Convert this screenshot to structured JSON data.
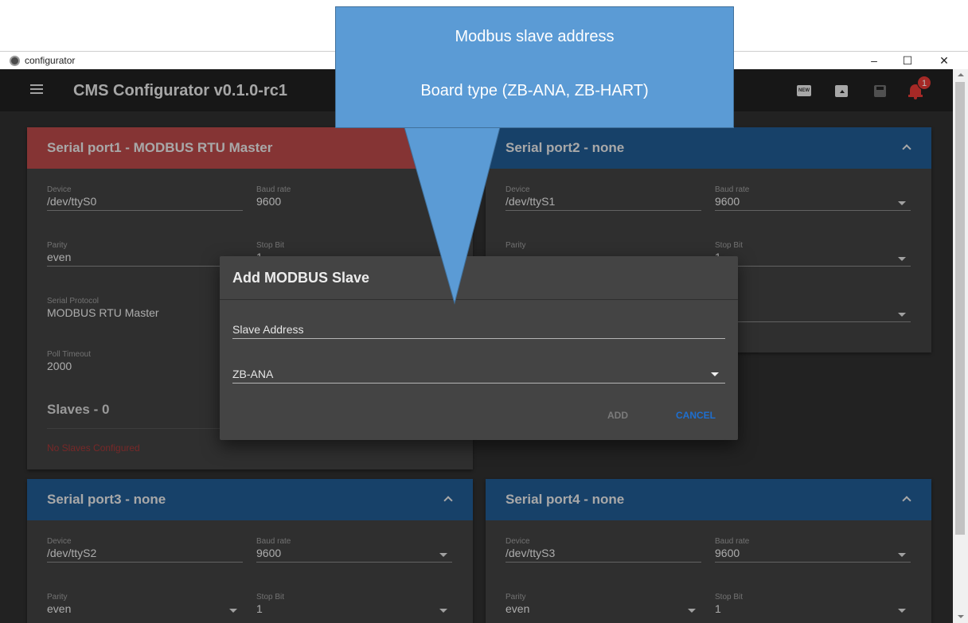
{
  "window": {
    "title": "configurator",
    "minimize": "–",
    "maximize": "☐",
    "close": "✕"
  },
  "appbar": {
    "title": "CMS Configurator v0.1.0-rc1",
    "new_label": "NEW",
    "notification_count": "1"
  },
  "colors": {
    "header_red": "#b94848",
    "header_blue": "#215a92",
    "accent": "#1e6fd0",
    "callout": "#5b9bd5"
  },
  "cards": {
    "port1": {
      "title": "Serial port1 - MODBUS RTU Master",
      "device_label": "Device",
      "device": "/dev/ttyS0",
      "baud_label": "Baud rate",
      "baud": "9600",
      "parity_label": "Parity",
      "parity": "even",
      "stop_label": "Stop Bit",
      "stop": "1",
      "protocol_label": "Serial Protocol",
      "protocol": "MODBUS RTU Master",
      "timeout_label": "Poll Timeout",
      "timeout": "2000",
      "slaves_title": "Slaves - 0",
      "no_slaves": "No Slaves Configured"
    },
    "port2": {
      "title": "Serial port2 - none",
      "device_label": "Device",
      "device": "/dev/ttyS1",
      "baud_label": "Baud rate",
      "baud": "9600",
      "parity_label": "Parity",
      "stop_label": "Stop Bit",
      "stop": "1"
    },
    "port3": {
      "title": "Serial port3 - none",
      "device_label": "Device",
      "device": "/dev/ttyS2",
      "baud_label": "Baud rate",
      "baud": "9600",
      "parity_label": "Parity",
      "parity": "even",
      "stop_label": "Stop Bit",
      "stop": "1"
    },
    "port4": {
      "title": "Serial port4 - none",
      "device_label": "Device",
      "device": "/dev/ttyS3",
      "baud_label": "Baud rate",
      "baud": "9600",
      "parity_label": "Parity",
      "parity": "even",
      "stop_label": "Stop Bit",
      "stop": "1"
    }
  },
  "dialog": {
    "title": "Add MODBUS Slave",
    "slave_address_placeholder": "Slave Address",
    "board_type": "ZB-ANA",
    "add_label": "ADD",
    "cancel_label": "CANCEL"
  },
  "callout": {
    "line1": "Modbus slave address",
    "line2": "Board type (ZB-ANA, ZB-HART)"
  }
}
